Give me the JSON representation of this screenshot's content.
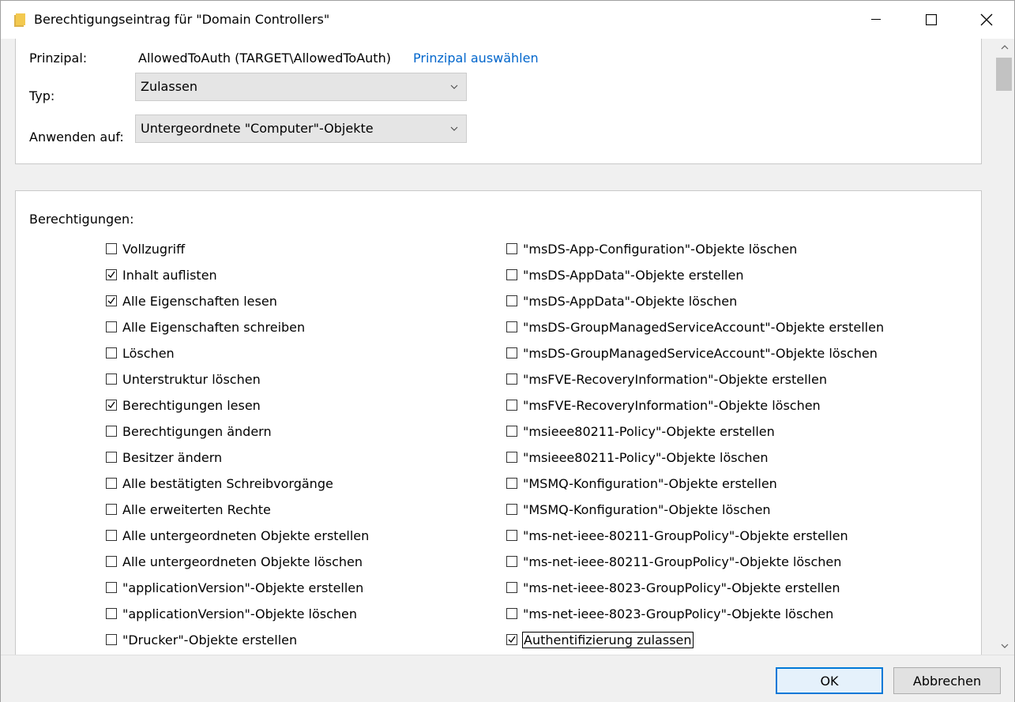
{
  "window": {
    "title": "Berechtigungseintrag für \"Domain Controllers\""
  },
  "principal": {
    "label": "Prinzipal:",
    "value": "AllowedToAuth (TARGET\\AllowedToAuth)",
    "select_link": "Prinzipal auswählen"
  },
  "type": {
    "label": "Typ:",
    "selected": "Zulassen"
  },
  "apply_to": {
    "label": "Anwenden auf:",
    "selected": "Untergeordnete \"Computer\"-Objekte"
  },
  "permissions": {
    "heading": "Berechtigungen:",
    "left": [
      {
        "label": "Vollzugriff",
        "checked": false
      },
      {
        "label": "Inhalt auflisten",
        "checked": true
      },
      {
        "label": "Alle Eigenschaften lesen",
        "checked": true
      },
      {
        "label": "Alle Eigenschaften schreiben",
        "checked": false
      },
      {
        "label": "Löschen",
        "checked": false
      },
      {
        "label": "Unterstruktur löschen",
        "checked": false
      },
      {
        "label": "Berechtigungen lesen",
        "checked": true
      },
      {
        "label": "Berechtigungen ändern",
        "checked": false
      },
      {
        "label": "Besitzer ändern",
        "checked": false
      },
      {
        "label": "Alle bestätigten Schreibvorgänge",
        "checked": false
      },
      {
        "label": "Alle erweiterten Rechte",
        "checked": false
      },
      {
        "label": "Alle untergeordneten Objekte erstellen",
        "checked": false
      },
      {
        "label": "Alle untergeordneten Objekte löschen",
        "checked": false
      },
      {
        "label": "\"applicationVersion\"-Objekte erstellen",
        "checked": false
      },
      {
        "label": "\"applicationVersion\"-Objekte löschen",
        "checked": false
      },
      {
        "label": "\"Drucker\"-Objekte erstellen",
        "checked": false
      }
    ],
    "right": [
      {
        "label": "\"msDS-App-Configuration\"-Objekte löschen",
        "checked": false
      },
      {
        "label": "\"msDS-AppData\"-Objekte erstellen",
        "checked": false
      },
      {
        "label": "\"msDS-AppData\"-Objekte löschen",
        "checked": false
      },
      {
        "label": "\"msDS-GroupManagedServiceAccount\"-Objekte erstellen",
        "checked": false
      },
      {
        "label": "\"msDS-GroupManagedServiceAccount\"-Objekte löschen",
        "checked": false
      },
      {
        "label": "\"msFVE-RecoveryInformation\"-Objekte erstellen",
        "checked": false
      },
      {
        "label": "\"msFVE-RecoveryInformation\"-Objekte löschen",
        "checked": false
      },
      {
        "label": "\"msieee80211-Policy\"-Objekte erstellen",
        "checked": false
      },
      {
        "label": "\"msieee80211-Policy\"-Objekte löschen",
        "checked": false
      },
      {
        "label": "\"MSMQ-Konfiguration\"-Objekte erstellen",
        "checked": false
      },
      {
        "label": "\"MSMQ-Konfiguration\"-Objekte löschen",
        "checked": false
      },
      {
        "label": "\"ms-net-ieee-80211-GroupPolicy\"-Objekte erstellen",
        "checked": false
      },
      {
        "label": "\"ms-net-ieee-80211-GroupPolicy\"-Objekte löschen",
        "checked": false
      },
      {
        "label": "\"ms-net-ieee-8023-GroupPolicy\"-Objekte erstellen",
        "checked": false
      },
      {
        "label": "\"ms-net-ieee-8023-GroupPolicy\"-Objekte löschen",
        "checked": false
      },
      {
        "label": "Authentifizierung zulassen",
        "checked": true,
        "focused": true
      }
    ]
  },
  "buttons": {
    "ok": "OK",
    "cancel": "Abbrechen"
  },
  "colors": {
    "link": "#0066cc",
    "focus_border": "#0078d7",
    "dialog_bg": "#f0f0f0"
  },
  "icons": {
    "title": "folder-icon",
    "minimize": "minimize-icon",
    "maximize": "maximize-icon",
    "close": "close-icon",
    "dropdown": "chevron-down-icon",
    "check": "check-icon"
  }
}
